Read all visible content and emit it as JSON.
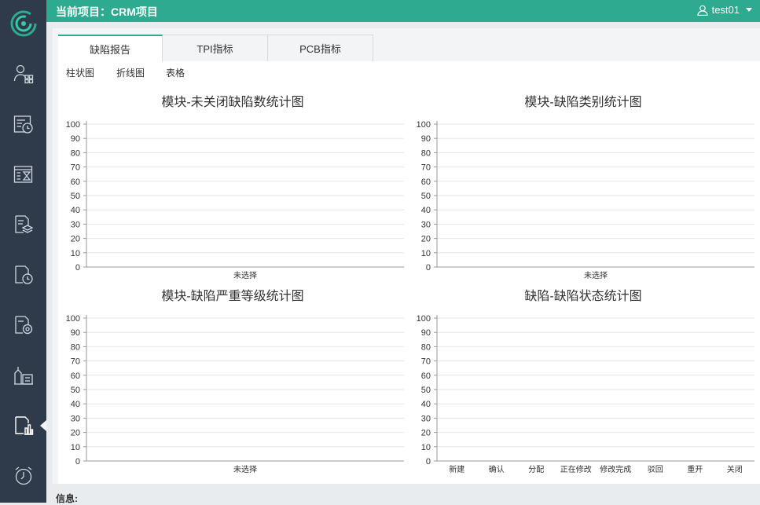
{
  "header": {
    "project_label": "当前项目：CRM项目",
    "username": "test01"
  },
  "sidebar": {
    "items": [
      {
        "name": "users-icon"
      },
      {
        "name": "schedule-icon"
      },
      {
        "name": "hourglass-icon"
      },
      {
        "name": "layers-icon"
      },
      {
        "name": "document-clock-icon"
      },
      {
        "name": "document-gear-icon"
      },
      {
        "name": "building-icon"
      },
      {
        "name": "bar-report-icon",
        "active": true
      },
      {
        "name": "alarm-clock-icon"
      }
    ]
  },
  "tabs": [
    "缺陷报告",
    "TPI指标",
    "PCB指标"
  ],
  "subtabs": [
    "柱状图",
    "折线图",
    "表格"
  ],
  "info_label": "信息:",
  "colors": {
    "accent": "#2daa8f",
    "sidebar": "#2f3a4b",
    "grid": "#e6e6e6"
  },
  "chart_data": [
    {
      "type": "bar",
      "title": "模块-未关闭缺陷数统计图",
      "categories": [
        "未选择"
      ],
      "values": [
        0
      ],
      "ylim": [
        0,
        100
      ],
      "yticks": [
        0,
        10,
        20,
        30,
        40,
        50,
        60,
        70,
        80,
        90,
        100
      ],
      "grid": true
    },
    {
      "type": "bar",
      "title": "模块-缺陷类别统计图",
      "categories": [
        "未选择"
      ],
      "values": [
        0
      ],
      "ylim": [
        0,
        100
      ],
      "yticks": [
        0,
        10,
        20,
        30,
        40,
        50,
        60,
        70,
        80,
        90,
        100
      ],
      "grid": true
    },
    {
      "type": "bar",
      "title": "模块-缺陷严重等级统计图",
      "categories": [
        "未选择"
      ],
      "values": [
        0
      ],
      "ylim": [
        0,
        100
      ],
      "yticks": [
        0,
        10,
        20,
        30,
        40,
        50,
        60,
        70,
        80,
        90,
        100
      ],
      "grid": true
    },
    {
      "type": "bar",
      "title": "缺陷-缺陷状态统计图",
      "categories": [
        "新建",
        "确认",
        "分配",
        "正在修改",
        "修改完成",
        "驳回",
        "重开",
        "关闭"
      ],
      "values": [
        0,
        0,
        0,
        0,
        0,
        0,
        0,
        0
      ],
      "ylim": [
        0,
        100
      ],
      "yticks": [
        0,
        10,
        20,
        30,
        40,
        50,
        60,
        70,
        80,
        90,
        100
      ],
      "grid": true
    }
  ]
}
